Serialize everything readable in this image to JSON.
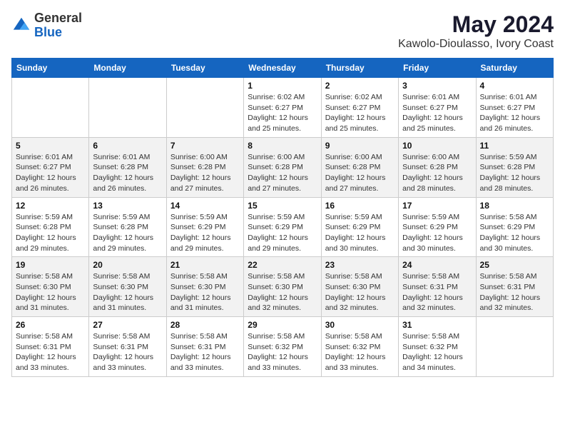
{
  "header": {
    "logo_general": "General",
    "logo_blue": "Blue",
    "title": "May 2024",
    "location": "Kawolo-Dioulasso, Ivory Coast"
  },
  "days_of_week": [
    "Sunday",
    "Monday",
    "Tuesday",
    "Wednesday",
    "Thursday",
    "Friday",
    "Saturday"
  ],
  "weeks": [
    [
      {
        "day": "",
        "info": ""
      },
      {
        "day": "",
        "info": ""
      },
      {
        "day": "",
        "info": ""
      },
      {
        "day": "1",
        "info": "Sunrise: 6:02 AM\nSunset: 6:27 PM\nDaylight: 12 hours\nand 25 minutes."
      },
      {
        "day": "2",
        "info": "Sunrise: 6:02 AM\nSunset: 6:27 PM\nDaylight: 12 hours\nand 25 minutes."
      },
      {
        "day": "3",
        "info": "Sunrise: 6:01 AM\nSunset: 6:27 PM\nDaylight: 12 hours\nand 25 minutes."
      },
      {
        "day": "4",
        "info": "Sunrise: 6:01 AM\nSunset: 6:27 PM\nDaylight: 12 hours\nand 26 minutes."
      }
    ],
    [
      {
        "day": "5",
        "info": "Sunrise: 6:01 AM\nSunset: 6:27 PM\nDaylight: 12 hours\nand 26 minutes."
      },
      {
        "day": "6",
        "info": "Sunrise: 6:01 AM\nSunset: 6:28 PM\nDaylight: 12 hours\nand 26 minutes."
      },
      {
        "day": "7",
        "info": "Sunrise: 6:00 AM\nSunset: 6:28 PM\nDaylight: 12 hours\nand 27 minutes."
      },
      {
        "day": "8",
        "info": "Sunrise: 6:00 AM\nSunset: 6:28 PM\nDaylight: 12 hours\nand 27 minutes."
      },
      {
        "day": "9",
        "info": "Sunrise: 6:00 AM\nSunset: 6:28 PM\nDaylight: 12 hours\nand 27 minutes."
      },
      {
        "day": "10",
        "info": "Sunrise: 6:00 AM\nSunset: 6:28 PM\nDaylight: 12 hours\nand 28 minutes."
      },
      {
        "day": "11",
        "info": "Sunrise: 5:59 AM\nSunset: 6:28 PM\nDaylight: 12 hours\nand 28 minutes."
      }
    ],
    [
      {
        "day": "12",
        "info": "Sunrise: 5:59 AM\nSunset: 6:28 PM\nDaylight: 12 hours\nand 29 minutes."
      },
      {
        "day": "13",
        "info": "Sunrise: 5:59 AM\nSunset: 6:28 PM\nDaylight: 12 hours\nand 29 minutes."
      },
      {
        "day": "14",
        "info": "Sunrise: 5:59 AM\nSunset: 6:29 PM\nDaylight: 12 hours\nand 29 minutes."
      },
      {
        "day": "15",
        "info": "Sunrise: 5:59 AM\nSunset: 6:29 PM\nDaylight: 12 hours\nand 29 minutes."
      },
      {
        "day": "16",
        "info": "Sunrise: 5:59 AM\nSunset: 6:29 PM\nDaylight: 12 hours\nand 30 minutes."
      },
      {
        "day": "17",
        "info": "Sunrise: 5:59 AM\nSunset: 6:29 PM\nDaylight: 12 hours\nand 30 minutes."
      },
      {
        "day": "18",
        "info": "Sunrise: 5:58 AM\nSunset: 6:29 PM\nDaylight: 12 hours\nand 30 minutes."
      }
    ],
    [
      {
        "day": "19",
        "info": "Sunrise: 5:58 AM\nSunset: 6:30 PM\nDaylight: 12 hours\nand 31 minutes."
      },
      {
        "day": "20",
        "info": "Sunrise: 5:58 AM\nSunset: 6:30 PM\nDaylight: 12 hours\nand 31 minutes."
      },
      {
        "day": "21",
        "info": "Sunrise: 5:58 AM\nSunset: 6:30 PM\nDaylight: 12 hours\nand 31 minutes."
      },
      {
        "day": "22",
        "info": "Sunrise: 5:58 AM\nSunset: 6:30 PM\nDaylight: 12 hours\nand 32 minutes."
      },
      {
        "day": "23",
        "info": "Sunrise: 5:58 AM\nSunset: 6:30 PM\nDaylight: 12 hours\nand 32 minutes."
      },
      {
        "day": "24",
        "info": "Sunrise: 5:58 AM\nSunset: 6:31 PM\nDaylight: 12 hours\nand 32 minutes."
      },
      {
        "day": "25",
        "info": "Sunrise: 5:58 AM\nSunset: 6:31 PM\nDaylight: 12 hours\nand 32 minutes."
      }
    ],
    [
      {
        "day": "26",
        "info": "Sunrise: 5:58 AM\nSunset: 6:31 PM\nDaylight: 12 hours\nand 33 minutes."
      },
      {
        "day": "27",
        "info": "Sunrise: 5:58 AM\nSunset: 6:31 PM\nDaylight: 12 hours\nand 33 minutes."
      },
      {
        "day": "28",
        "info": "Sunrise: 5:58 AM\nSunset: 6:31 PM\nDaylight: 12 hours\nand 33 minutes."
      },
      {
        "day": "29",
        "info": "Sunrise: 5:58 AM\nSunset: 6:32 PM\nDaylight: 12 hours\nand 33 minutes."
      },
      {
        "day": "30",
        "info": "Sunrise: 5:58 AM\nSunset: 6:32 PM\nDaylight: 12 hours\nand 33 minutes."
      },
      {
        "day": "31",
        "info": "Sunrise: 5:58 AM\nSunset: 6:32 PM\nDaylight: 12 hours\nand 34 minutes."
      },
      {
        "day": "",
        "info": ""
      }
    ]
  ]
}
